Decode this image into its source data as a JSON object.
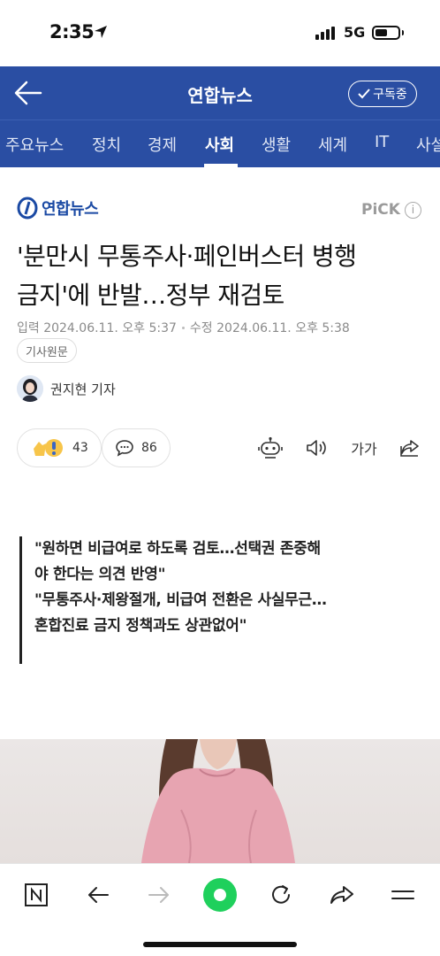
{
  "status_bar": {
    "time": "2:35",
    "network": "5G"
  },
  "app_header": {
    "back_icon": "arrow-left-icon",
    "title": "연합뉴스",
    "subscribe_label": "구독중"
  },
  "categories": [
    "주요뉴스",
    "정치",
    "경제",
    "사회",
    "생활",
    "세계",
    "IT",
    "사설"
  ],
  "active_category": "사회",
  "article": {
    "publisher": "연합뉴스",
    "pick_label": "PiCK",
    "headline_line1": "'분만시 무통주사·페인버스터 병행",
    "headline_line2": "금지'에 반발…정부 재검토",
    "input_date": "입력 2024.06.11. 오후 5:37",
    "modified_date": "수정 2024.06.11. 오후 5:38",
    "original_label": "기사원문",
    "reporter": "권지현 기자",
    "reactions_count": "43",
    "comments_count": "86",
    "font_size_label": "가가",
    "quote_lines": [
      "\"원하면 비급여로 하도록 검토…선택권 존중해",
      "야 한다는 의견 반영\"",
      "\"무통주사·제왕절개, 비급여 전환은 사실무근…",
      "혼합진료 금지 정책과도 상관없어\""
    ]
  },
  "colors": {
    "header_bg": "#2a4ea3",
    "brand_blue": "#1b4aa4",
    "toolbar_green": "#1fd05c"
  }
}
